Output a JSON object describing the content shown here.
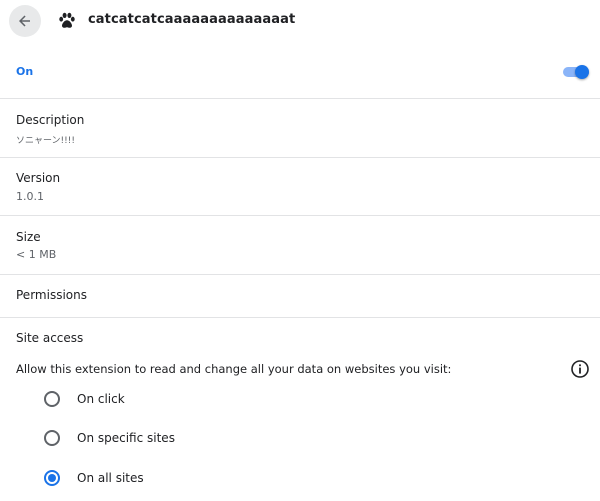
{
  "header": {
    "back_icon": "arrow-left-icon",
    "extension_icon": "paw-icon",
    "extension_name": "catcatcatcaaaaaaaaaaaaaat"
  },
  "toggle": {
    "label": "On",
    "enabled": true,
    "accent_color": "#1a73e8"
  },
  "description": {
    "label": "Description",
    "value": "ソニャーン!!!!"
  },
  "version": {
    "label": "Version",
    "value": "1.0.1"
  },
  "size": {
    "label": "Size",
    "value": "< 1 MB"
  },
  "permissions": {
    "label": "Permissions"
  },
  "site_access": {
    "label": "Site access",
    "prompt": "Allow this extension to read and change all your data on websites you visit:",
    "info_icon": "info-icon",
    "options": [
      {
        "label": "On click",
        "selected": false
      },
      {
        "label": "On specific sites",
        "selected": false
      },
      {
        "label": "On all sites",
        "selected": true
      }
    ]
  }
}
